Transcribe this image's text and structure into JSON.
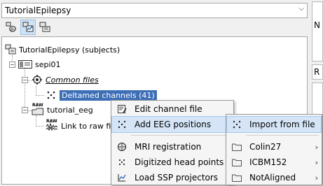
{
  "protocol_selector": {
    "value": "TutorialEpilepsy"
  },
  "toolbar": {
    "buttons": [
      {
        "name": "anatomy-view",
        "icon": "brain-icon",
        "active": false
      },
      {
        "name": "functional-subjects-view",
        "icon": "subject-data-icon",
        "active": true
      },
      {
        "name": "functional-conditions-view",
        "icon": "condition-data-icon",
        "active": false
      }
    ]
  },
  "tree": {
    "root_label": "TutorialEpilepsy (subjects)",
    "subject_label": "sepi01",
    "common_files_label": "Common files",
    "channel_file_label": "Deltamed channels (41)",
    "raw_folder_label": "tutorial_eeg",
    "raw_link_label": "Link to raw file",
    "raw_badge": "RAW"
  },
  "context_menu": {
    "items": [
      {
        "label": "Edit channel file",
        "icon": "edit-file-icon",
        "submenu": false
      },
      {
        "label": "Add EEG positions",
        "icon": "eeg-dots-icon",
        "submenu": true,
        "highlighted": true
      },
      {
        "label": "MRI registration",
        "icon": "head-icon",
        "submenu": true
      },
      {
        "label": "Digitized head points",
        "icon": "dots-icon",
        "submenu": true
      },
      {
        "label": "Load SSP projectors",
        "icon": "projector-icon",
        "submenu": false
      }
    ]
  },
  "submenu": {
    "items": [
      {
        "label": "Import from file",
        "icon": "eeg-dots-icon",
        "submenu": false,
        "highlighted": true
      },
      {
        "label": "Colin27",
        "icon": "folder-icon",
        "submenu": true
      },
      {
        "label": "ICBM152",
        "icon": "folder-icon",
        "submenu": true
      },
      {
        "label": "NotAligned",
        "icon": "folder-icon",
        "submenu": true
      }
    ]
  },
  "right_panel": {
    "labels": [
      "N",
      "R"
    ]
  },
  "colors": {
    "selection": "#3d6fb7",
    "menu_highlight": "#d5e5f7"
  }
}
